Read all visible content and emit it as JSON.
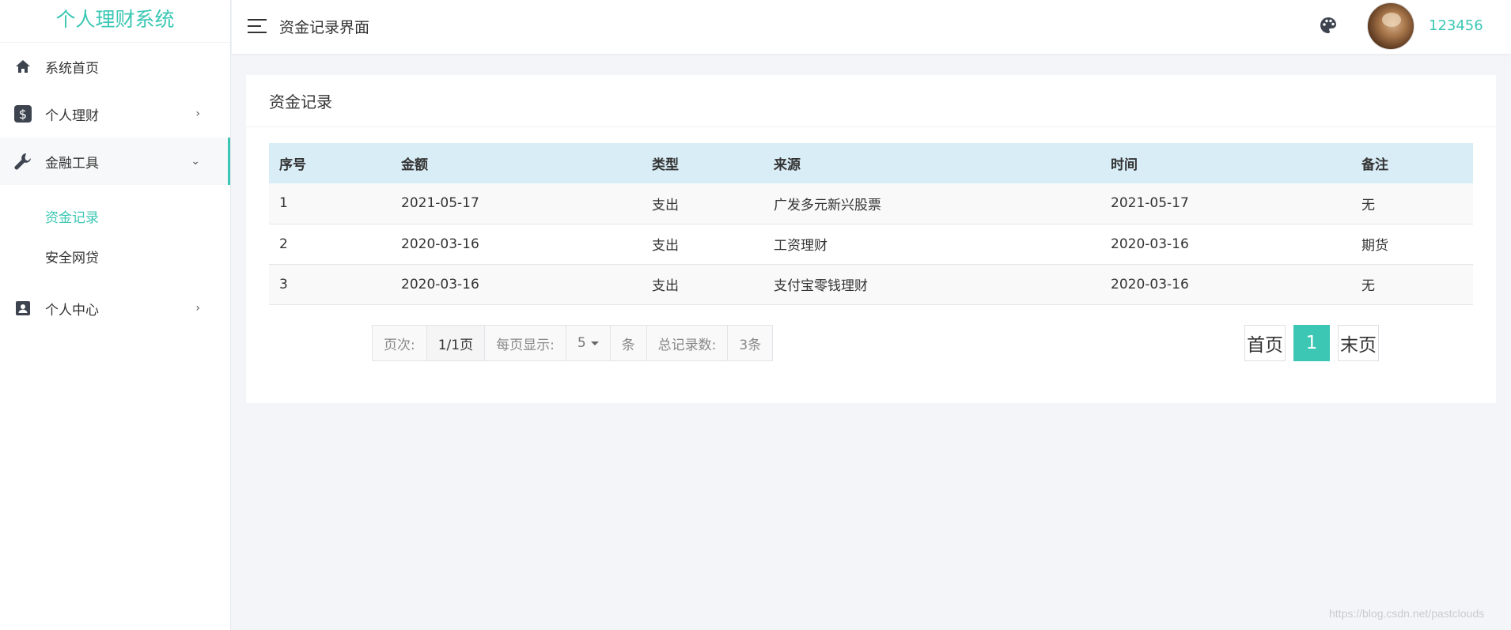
{
  "app": {
    "title": "个人理财系统"
  },
  "sidebar": {
    "items": [
      {
        "label": "系统首页",
        "icon": "home-icon"
      },
      {
        "label": "个人理财",
        "icon": "dollar-icon"
      },
      {
        "label": "金融工具",
        "icon": "wrench-icon"
      },
      {
        "label": "个人中心",
        "icon": "user-badge-icon"
      }
    ],
    "submenu": [
      {
        "label": "资金记录"
      },
      {
        "label": "安全网贷"
      }
    ]
  },
  "header": {
    "title": "资金记录界面",
    "username": "123456"
  },
  "card": {
    "title": "资金记录"
  },
  "table": {
    "headers": [
      "序号",
      "金额",
      "类型",
      "来源",
      "时间",
      "备注"
    ],
    "rows": [
      [
        "1",
        "2021-05-17",
        "支出",
        "广发多元新兴股票",
        "2021-05-17",
        "无"
      ],
      [
        "2",
        "2020-03-16",
        "支出",
        "工资理财",
        "2020-03-16",
        "期货"
      ],
      [
        "3",
        "2020-03-16",
        "支出",
        "支付宝零钱理财",
        "2020-03-16",
        "无"
      ]
    ]
  },
  "pager": {
    "page_label": "页次:",
    "page_value": "1/1页",
    "per_page_label": "每页显示:",
    "per_page_value": "5",
    "unit": "条",
    "total_label": "总记录数:",
    "total_value": "3条",
    "first": "首页",
    "current": "1",
    "last": "末页"
  },
  "watermark": "https://blog.csdn.net/pastclouds",
  "colors": {
    "accent": "#3cc7b4",
    "table_header": "#d9edf6"
  }
}
